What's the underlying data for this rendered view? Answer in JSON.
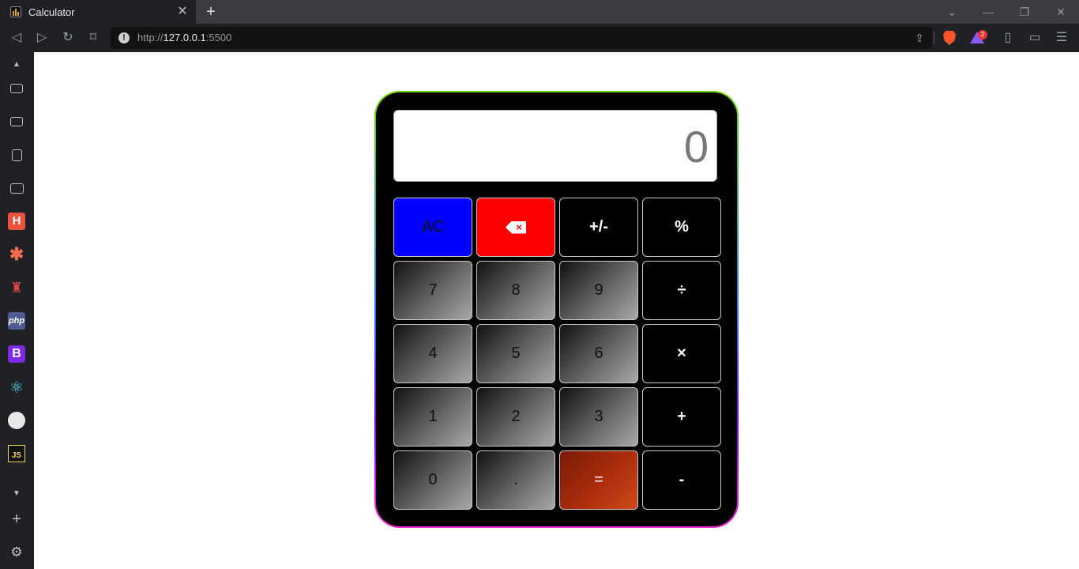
{
  "browser": {
    "tab_title": "Calculator",
    "url_scheme": "http://",
    "url_host": "127.0.0.1",
    "url_port": ":5500",
    "rewards_count": "2"
  },
  "calculator": {
    "display_value": "0",
    "buttons": {
      "ac": "AC",
      "delete_icon": "backspace-x",
      "negate": "+/-",
      "percent": "%",
      "seven": "7",
      "eight": "8",
      "nine": "9",
      "divide": "÷",
      "four": "4",
      "five": "5",
      "six": "6",
      "multiply": "×",
      "one": "1",
      "two": "2",
      "three": "3",
      "plus": "+",
      "zero": "0",
      "decimal": ".",
      "equals": "=",
      "minus": "-"
    }
  },
  "colors": {
    "ac_bg": "#0000ff",
    "delete_bg": "#ff0000",
    "equals_bg": "#b0300d"
  }
}
